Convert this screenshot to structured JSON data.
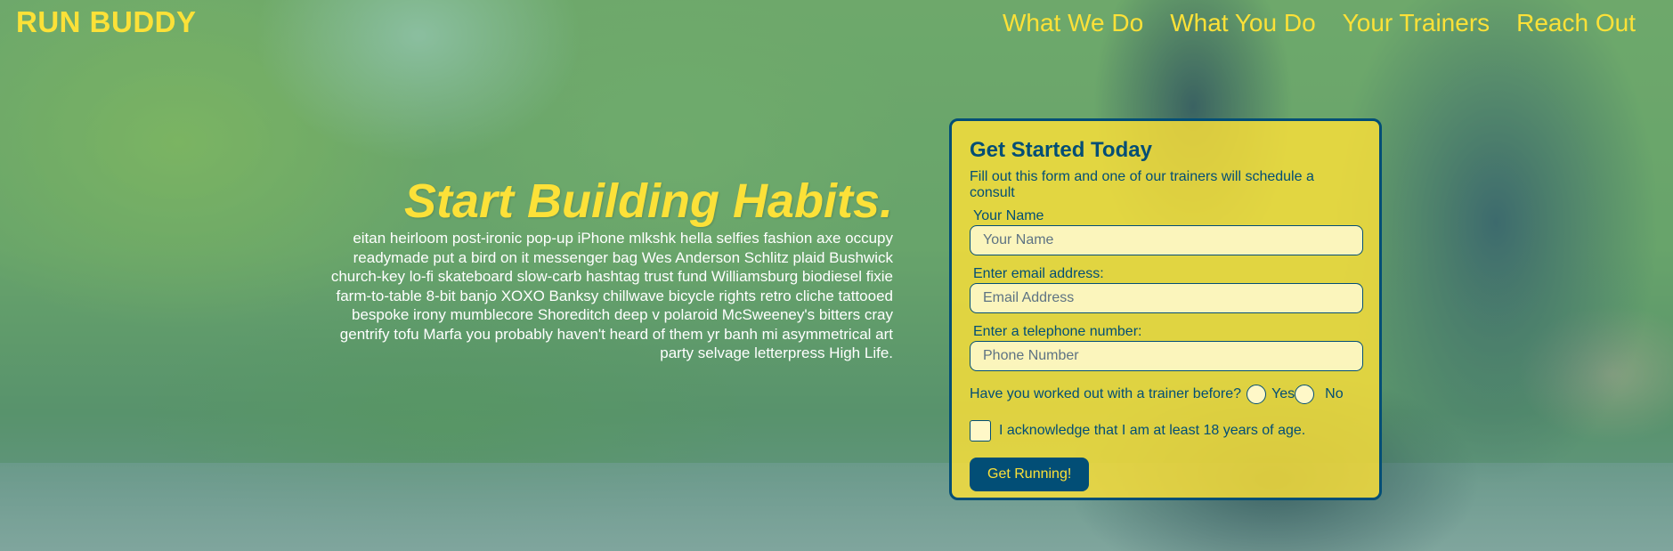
{
  "header": {
    "logo": "RUN BUDDY",
    "nav": [
      {
        "label": "What We Do"
      },
      {
        "label": "What You Do"
      },
      {
        "label": "Your Trainers"
      },
      {
        "label": "Reach Out"
      }
    ]
  },
  "hero": {
    "title": "Start Building Habits.",
    "body": "eitan heirloom post-ironic pop-up iPhone mlkshk hella selfies fashion axe occupy readymade put a bird on it messenger bag Wes Anderson Schlitz plaid Bushwick church-key lo-fi skateboard slow-carb hashtag trust fund Williamsburg biodiesel fixie farm-to-table 8-bit banjo XOXO Banksy chillwave bicycle rights retro cliche tattooed bespoke irony mumblecore Shoreditch deep v polaroid McSweeney's bitters cray gentrify tofu Marfa you probably haven't heard of them yr banh mi asymmetrical art party selvage letterpress High Life."
  },
  "form": {
    "title": "Get Started Today",
    "subtitle": "Fill out this form and one of our trainers will schedule a consult",
    "name_label": "Your Name",
    "name_placeholder": "Your Name",
    "email_label": "Enter email address:",
    "email_placeholder": "Email Address",
    "phone_label": "Enter a telephone number:",
    "phone_placeholder": "Phone Number",
    "trainer_question": "Have you worked out with a trainer before?",
    "yes_label": "Yes",
    "no_label": "No",
    "age_ack": "I acknowledge that I am at least 18 years of age.",
    "submit_label": "Get Running!"
  },
  "colors": {
    "brand_yellow": "#fce138",
    "brand_blue": "#024e76"
  }
}
